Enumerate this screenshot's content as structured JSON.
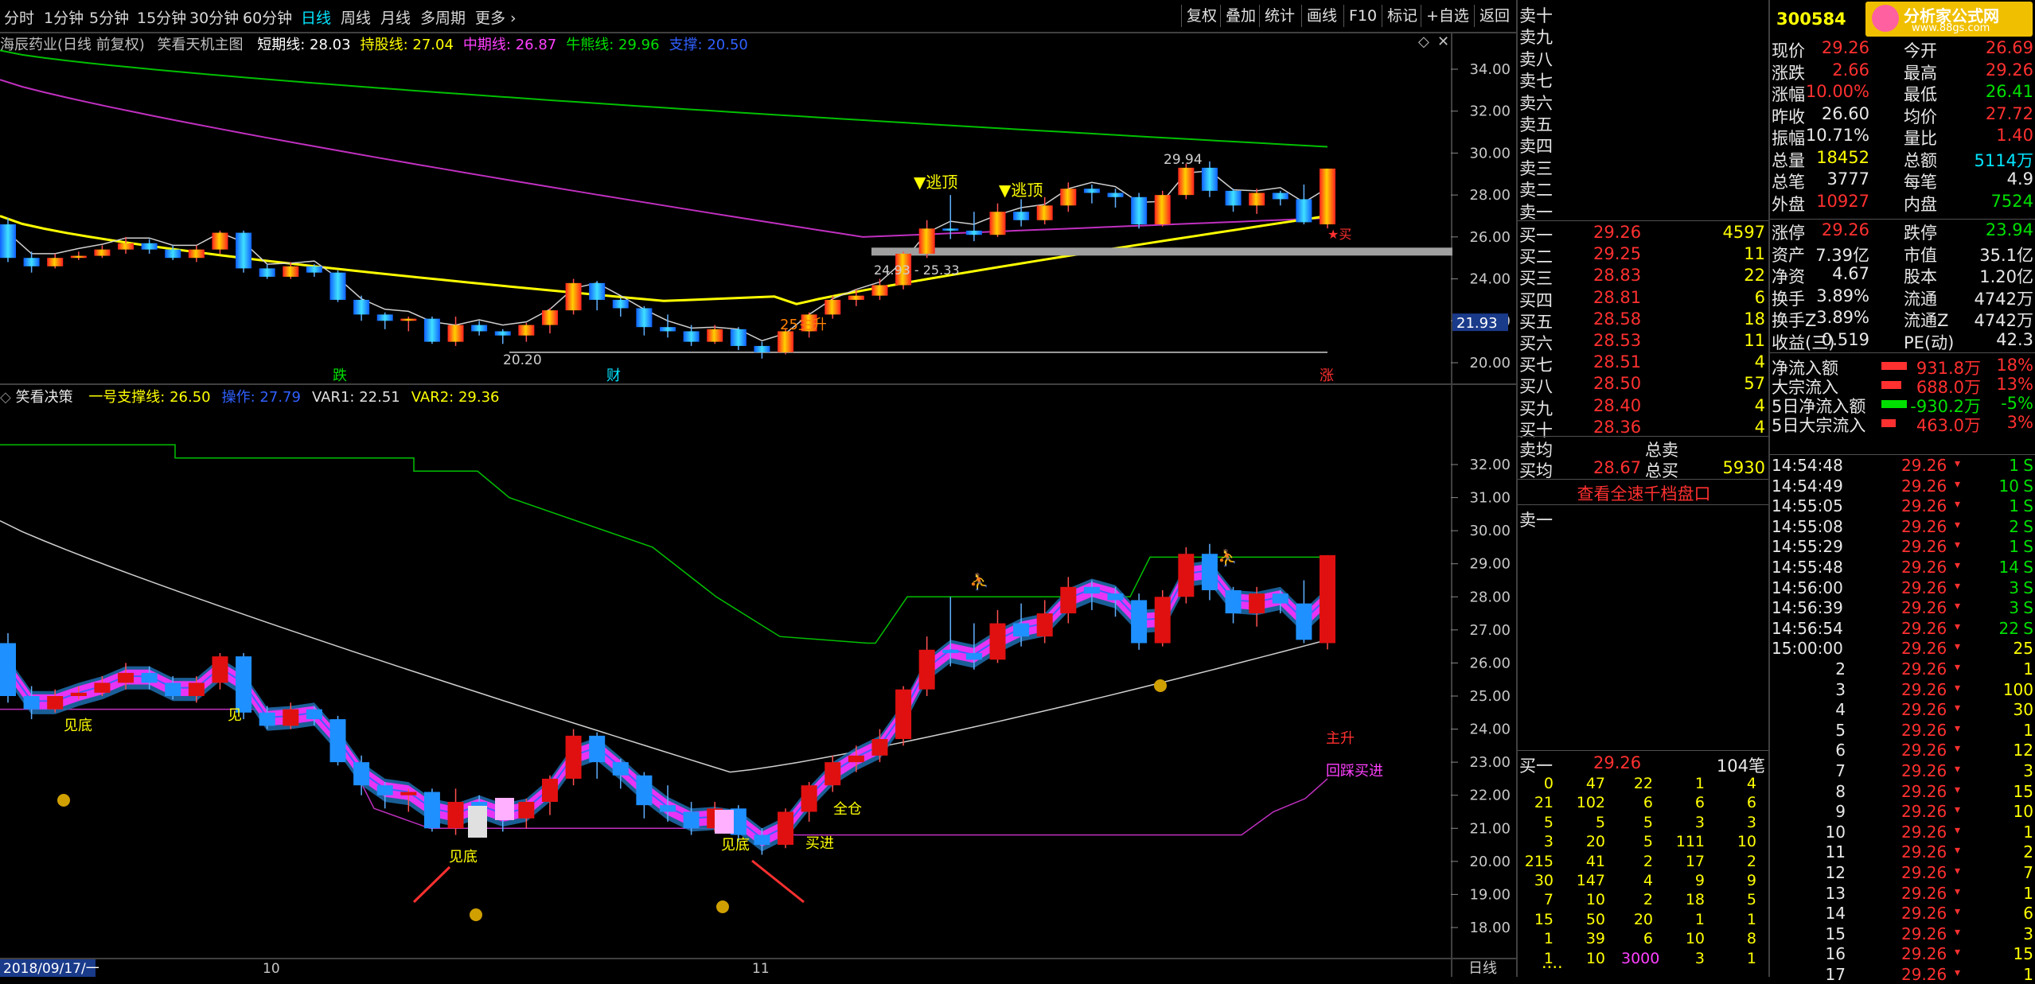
{
  "toolbar": {
    "periods": [
      "分时",
      "1分钟",
      "5分钟",
      "15分钟",
      "30分钟",
      "60分钟",
      "日线",
      "周线",
      "月线",
      "多周期",
      "更多"
    ],
    "active_index": 6,
    "buttons": [
      "复权",
      "叠加",
      "统计",
      "画线",
      "F10",
      "标记",
      "+自选",
      "返回"
    ]
  },
  "main_chart": {
    "title": "海辰药业(日线 前复权)",
    "indicator": "笑看天机主图",
    "legend": [
      {
        "label": "短期线: 28.03",
        "color": "#ffffff"
      },
      {
        "label": "持股线: 27.04",
        "color": "#ffff00"
      },
      {
        "label": "中期线: 26.87",
        "color": "#ff40ff"
      },
      {
        "label": "牛熊线: 29.96",
        "color": "#00e000"
      },
      {
        "label": "支撑: 20.50",
        "color": "#3060ff"
      }
    ],
    "y_ticks": [
      "34.00",
      "32.00",
      "30.00",
      "28.00",
      "26.00",
      "24.00",
      "22.00",
      "20.00"
    ],
    "current_price_tag": "21.93",
    "annotations": {
      "escape": "▼逃顶",
      "escape2": "▼逃顶",
      "high_mark": "29.94",
      "low_mark": "20.20",
      "rise": "25主升",
      "range": "24.93 - 25.33",
      "buy": "★买",
      "die": "跌",
      "cai": "财",
      "zhang": "涨"
    }
  },
  "sub_chart": {
    "title": "笑看决策",
    "legend": [
      {
        "label": "一号支撑线: 26.50",
        "color": "#ffff00"
      },
      {
        "label": "操作: 27.79",
        "color": "#3060ff"
      },
      {
        "label": "VAR1: 22.51",
        "color": "#e0e0e0"
      },
      {
        "label": "VAR2: 29.36",
        "color": "#ffff00"
      }
    ],
    "y_ticks": [
      "32.00",
      "31.00",
      "30.00",
      "29.00",
      "28.00",
      "27.00",
      "26.00",
      "25.00",
      "24.00",
      "23.00",
      "22.00",
      "21.00",
      "20.00",
      "19.00",
      "18.00"
    ],
    "annotations": {
      "bottom1": "见底",
      "bottom2": "见",
      "bottom3": "见底",
      "bottom4": "见底",
      "full": "全仓",
      "buy_in": "买进",
      "main_rise": "主升",
      "pullback_buy": "回踩买进"
    }
  },
  "x_axis": {
    "start": "2018/09/17/一",
    "m10": "10",
    "m11": "11",
    "period": "日线"
  },
  "order_book": {
    "sell_labels": [
      "卖十",
      "卖九",
      "卖八",
      "卖七",
      "卖六",
      "卖五",
      "卖四",
      "卖三",
      "卖二",
      "卖一"
    ],
    "buy": [
      {
        "label": "买一",
        "price": "29.26",
        "vol": "4597"
      },
      {
        "label": "买二",
        "price": "29.25",
        "vol": "11"
      },
      {
        "label": "买三",
        "price": "28.83",
        "vol": "22"
      },
      {
        "label": "买四",
        "price": "28.81",
        "vol": "6"
      },
      {
        "label": "买五",
        "price": "28.58",
        "vol": "18"
      },
      {
        "label": "买六",
        "price": "28.53",
        "vol": "11"
      },
      {
        "label": "买七",
        "price": "28.51",
        "vol": "4"
      },
      {
        "label": "买八",
        "price": "28.50",
        "vol": "57"
      },
      {
        "label": "买九",
        "price": "28.40",
        "vol": "4"
      },
      {
        "label": "买十",
        "price": "28.36",
        "vol": "4"
      }
    ],
    "avg_sell": "卖均",
    "total_sell": "总卖",
    "avg_buy": "买均",
    "avg_buy_price": "28.67",
    "total_buy": "总买",
    "total_buy_vol": "5930",
    "link": "查看全速千档盘口",
    "queue_label": "卖一",
    "queue_buy_label": "买一",
    "queue_buy_price": "29.26",
    "queue_buy_count": "104笔",
    "queue_rows": [
      [
        "0",
        "47",
        "22",
        "1",
        "4"
      ],
      [
        "21",
        "102",
        "6",
        "6",
        "6"
      ],
      [
        "5",
        "5",
        "5",
        "3",
        "3"
      ],
      [
        "3",
        "20",
        "5",
        "111",
        "10"
      ],
      [
        "215",
        "41",
        "2",
        "17",
        "2"
      ],
      [
        "30",
        "147",
        "4",
        "9",
        "9"
      ],
      [
        "7",
        "10",
        "2",
        "18",
        "5"
      ],
      [
        "15",
        "50",
        "20",
        "1",
        "1"
      ],
      [
        "1",
        "39",
        "6",
        "10",
        "8"
      ],
      [
        "1",
        "10",
        "3000",
        "3",
        "1"
      ]
    ],
    "dots": "...."
  },
  "quote": {
    "code": "300584",
    "logo_text": "分析家公式网",
    "logo_url": "www.88gs.com",
    "rows": [
      {
        "l1": "现价",
        "v1": "29.26",
        "c1": "#ff3030",
        "l2": "今开",
        "v2": "26.69",
        "c2": "#ff3030"
      },
      {
        "l1": "涨跌",
        "v1": "2.66",
        "c1": "#ff3030",
        "l2": "最高",
        "v2": "29.26",
        "c2": "#ff3030"
      },
      {
        "l1": "涨幅",
        "v1": "10.00%",
        "c1": "#ff3030",
        "l2": "最低",
        "v2": "26.41",
        "c2": "#00e000"
      },
      {
        "l1": "昨收",
        "v1": "26.60",
        "c1": "#e8e8e8",
        "l2": "均价",
        "v2": "27.72",
        "c2": "#ff3030"
      },
      {
        "l1": "振幅",
        "v1": "10.71%",
        "c1": "#e8e8e8",
        "l2": "量比",
        "v2": "1.40",
        "c2": "#ff3030"
      },
      {
        "l1": "总量",
        "v1": "18452",
        "c1": "#ffff00",
        "l2": "总额",
        "v2": "5114万",
        "c2": "#00e5ff"
      },
      {
        "l1": "总笔",
        "v1": "3777",
        "c1": "#e8e8e8",
        "l2": "每笔",
        "v2": "4.9",
        "c2": "#e8e8e8"
      },
      {
        "l1": "外盘",
        "v1": "10927",
        "c1": "#ff3030",
        "l2": "内盘",
        "v2": "7524",
        "c2": "#00e000"
      }
    ],
    "rows2": [
      {
        "l1": "涨停",
        "v1": "29.26",
        "c1": "#ff3030",
        "l2": "跌停",
        "v2": "23.94",
        "c2": "#00e000"
      },
      {
        "l1": "资产",
        "v1": "7.39亿",
        "c1": "#e8e8e8",
        "l2": "市值",
        "v2": "35.1亿",
        "c2": "#e8e8e8"
      },
      {
        "l1": "净资",
        "v1": "4.67",
        "c1": "#e8e8e8",
        "l2": "股本",
        "v2": "1.20亿",
        "c2": "#e8e8e8"
      },
      {
        "l1": "换手",
        "v1": "3.89%",
        "c1": "#e8e8e8",
        "l2": "流通",
        "v2": "4742万",
        "c2": "#e8e8e8"
      },
      {
        "l1": "换手Z",
        "v1": "3.89%",
        "c1": "#e8e8e8",
        "l2": "流通Z",
        "v2": "4742万",
        "c2": "#e8e8e8"
      },
      {
        "l1": "收益(三)",
        "v1": "0.519",
        "c1": "#e8e8e8",
        "l2": "PE(动)",
        "v2": "42.3",
        "c2": "#e8e8e8"
      }
    ],
    "flows": [
      {
        "label": "净流入额",
        "value": "931.8万",
        "pct": "18%",
        "color": "#ff3030",
        "bar": 0.45
      },
      {
        "label": "大宗流入",
        "value": "688.0万",
        "pct": "13%",
        "color": "#ff3030",
        "bar": 0.35
      },
      {
        "label": "5日净流入额",
        "value": "-930.2万",
        "pct": "-5%",
        "color": "#00e000",
        "bar": 0.45
      },
      {
        "label": "5日大宗流入",
        "value": "463.0万",
        "pct": "3%",
        "color": "#ff3030",
        "bar": 0.25
      }
    ],
    "ticks": [
      {
        "t": "14:54:48",
        "p": "29.26",
        "v": "1",
        "d": "S"
      },
      {
        "t": "14:54:49",
        "p": "29.26",
        "v": "10",
        "d": "S"
      },
      {
        "t": "14:55:05",
        "p": "29.26",
        "v": "1",
        "d": "S"
      },
      {
        "t": "14:55:08",
        "p": "29.26",
        "v": "2",
        "d": "S"
      },
      {
        "t": "14:55:29",
        "p": "29.26",
        "v": "1",
        "d": "S"
      },
      {
        "t": "14:55:48",
        "p": "29.26",
        "v": "14",
        "d": "S"
      },
      {
        "t": "14:56:00",
        "p": "29.26",
        "v": "3",
        "d": "S"
      },
      {
        "t": "14:56:39",
        "p": "29.26",
        "v": "3",
        "d": "S"
      },
      {
        "t": "14:56:54",
        "p": "29.26",
        "v": "22",
        "d": "S"
      },
      {
        "t": "15:00:00",
        "p": "29.26",
        "v": "25",
        "d": ""
      },
      {
        "t": "2",
        "p": "29.26",
        "v": "1",
        "d": ""
      },
      {
        "t": "3",
        "p": "29.26",
        "v": "100",
        "d": ""
      },
      {
        "t": "4",
        "p": "29.26",
        "v": "30",
        "d": ""
      },
      {
        "t": "5",
        "p": "29.26",
        "v": "1",
        "d": ""
      },
      {
        "t": "6",
        "p": "29.26",
        "v": "12",
        "d": ""
      },
      {
        "t": "7",
        "p": "29.26",
        "v": "3",
        "d": ""
      },
      {
        "t": "8",
        "p": "29.26",
        "v": "15",
        "d": ""
      },
      {
        "t": "9",
        "p": "29.26",
        "v": "10",
        "d": ""
      },
      {
        "t": "10",
        "p": "29.26",
        "v": "1",
        "d": ""
      },
      {
        "t": "11",
        "p": "29.26",
        "v": "2",
        "d": ""
      },
      {
        "t": "12",
        "p": "29.26",
        "v": "7",
        "d": ""
      },
      {
        "t": "13",
        "p": "29.26",
        "v": "1",
        "d": ""
      },
      {
        "t": "14",
        "p": "29.26",
        "v": "6",
        "d": ""
      },
      {
        "t": "15",
        "p": "29.26",
        "v": "3",
        "d": ""
      },
      {
        "t": "16",
        "p": "29.26",
        "v": "15",
        "d": ""
      },
      {
        "t": "17",
        "p": "29.26",
        "v": "1",
        "d": ""
      }
    ]
  },
  "candles": [
    [
      26.6,
      25.0,
      26.9,
      24.8
    ],
    [
      25.0,
      24.6,
      25.3,
      24.3
    ],
    [
      24.6,
      25.0,
      25.2,
      24.5
    ],
    [
      25.0,
      25.1,
      25.3,
      24.9
    ],
    [
      25.1,
      25.4,
      25.6,
      25.0
    ],
    [
      25.4,
      25.7,
      26.0,
      25.2
    ],
    [
      25.7,
      25.4,
      25.9,
      25.2
    ],
    [
      25.4,
      25.0,
      25.6,
      24.9
    ],
    [
      25.0,
      25.4,
      25.6,
      24.8
    ],
    [
      25.4,
      26.2,
      26.3,
      25.2
    ],
    [
      26.2,
      24.5,
      26.3,
      24.3
    ],
    [
      24.5,
      24.1,
      24.7,
      24.0
    ],
    [
      24.1,
      24.6,
      24.8,
      24.0
    ],
    [
      24.6,
      24.3,
      24.7,
      24.1
    ],
    [
      24.3,
      23.0,
      24.4,
      22.9
    ],
    [
      23.0,
      22.3,
      23.2,
      22.0
    ],
    [
      22.3,
      22.0,
      22.4,
      21.6
    ],
    [
      22.0,
      22.1,
      22.2,
      21.5
    ],
    [
      22.1,
      21.0,
      22.2,
      20.9
    ],
    [
      21.0,
      21.8,
      22.2,
      20.8
    ],
    [
      21.8,
      21.5,
      22.0,
      21.3
    ],
    [
      21.5,
      21.3,
      21.6,
      20.9
    ],
    [
      21.3,
      21.8,
      21.9,
      21.0
    ],
    [
      21.8,
      22.5,
      22.6,
      21.4
    ],
    [
      22.5,
      23.8,
      24.0,
      22.3
    ],
    [
      23.8,
      23.0,
      23.9,
      22.5
    ],
    [
      23.0,
      22.6,
      23.1,
      22.2
    ],
    [
      22.6,
      21.7,
      22.7,
      21.3
    ],
    [
      21.7,
      21.5,
      22.3,
      21.2
    ],
    [
      21.5,
      21.0,
      21.8,
      20.8
    ],
    [
      21.0,
      21.6,
      21.8,
      20.9
    ],
    [
      21.6,
      20.8,
      21.7,
      20.6
    ],
    [
      20.8,
      20.5,
      21.0,
      20.2
    ],
    [
      20.5,
      21.5,
      21.6,
      20.4
    ],
    [
      21.5,
      22.3,
      22.4,
      21.2
    ],
    [
      22.3,
      23.0,
      23.2,
      22.1
    ],
    [
      23.0,
      23.2,
      23.5,
      22.7
    ],
    [
      23.2,
      23.7,
      24.0,
      23.0
    ],
    [
      23.7,
      25.2,
      25.3,
      23.5
    ],
    [
      25.2,
      26.4,
      26.8,
      25.0
    ],
    [
      26.4,
      26.3,
      28.0,
      25.9
    ],
    [
      26.3,
      26.1,
      27.2,
      25.8
    ],
    [
      26.1,
      27.2,
      27.6,
      26.0
    ],
    [
      27.2,
      26.8,
      27.8,
      26.5
    ],
    [
      26.8,
      27.5,
      27.9,
      26.6
    ],
    [
      27.5,
      28.3,
      28.6,
      27.2
    ],
    [
      28.3,
      28.1,
      28.5,
      27.6
    ],
    [
      28.1,
      27.9,
      28.3,
      27.4
    ],
    [
      27.9,
      26.6,
      28.1,
      26.4
    ],
    [
      26.6,
      28.0,
      28.2,
      26.5
    ],
    [
      28.0,
      29.3,
      29.5,
      27.8
    ],
    [
      29.3,
      28.2,
      29.6,
      27.9
    ],
    [
      28.2,
      27.5,
      28.3,
      27.2
    ],
    [
      27.5,
      28.1,
      28.3,
      27.1
    ],
    [
      28.1,
      27.8,
      28.2,
      27.5
    ],
    [
      27.8,
      26.7,
      28.5,
      26.6
    ],
    [
      26.6,
      29.26,
      29.26,
      26.41
    ]
  ]
}
